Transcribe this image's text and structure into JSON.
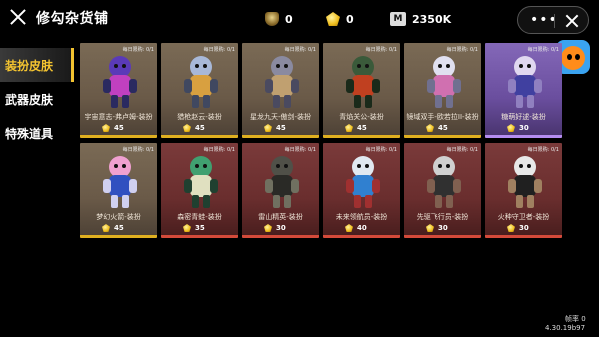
{
  "header": {
    "title": "修勾杂货铺",
    "currencies": [
      {
        "icon": "shield-coin-icon",
        "value": "0"
      },
      {
        "icon": "gold-coin-icon",
        "value": "0"
      },
      {
        "icon": "m-coin-icon",
        "label": "M",
        "value": "2350K"
      }
    ],
    "capsule": {
      "more": "•••"
    }
  },
  "sidebar": {
    "items": [
      {
        "label": "装扮皮肤",
        "active": true
      },
      {
        "label": "武器皮肤",
        "active": false
      },
      {
        "label": "特殊道具",
        "active": false
      }
    ]
  },
  "cards": [
    {
      "limit": "每日限购: 0/1",
      "name": "宇宙意志-弗卢姆-装扮",
      "price": "45",
      "rarity": "gold",
      "colors": [
        "#5a3ab8",
        "#c040c0",
        "#2a2a60"
      ]
    },
    {
      "limit": "每日限购: 0/1",
      "name": "猎枪赵云-装扮",
      "price": "45",
      "rarity": "gold",
      "colors": [
        "#a8b8d8",
        "#d8a040",
        "#404860"
      ]
    },
    {
      "limit": "每日限购: 0/1",
      "name": "星龙九天-傲剑-装扮",
      "price": "45",
      "rarity": "gold",
      "colors": [
        "#8a8aa0",
        "#c0a070",
        "#4a4a60"
      ]
    },
    {
      "limit": "每日限购: 0/1",
      "name": "青焰关公-装扮",
      "price": "45",
      "rarity": "gold",
      "colors": [
        "#3a5a3a",
        "#c04020",
        "#1a2a1a"
      ]
    },
    {
      "limit": "每日限购: 0/1",
      "name": "镜域双手-欧若拉II-装扮",
      "price": "45",
      "rarity": "gold",
      "colors": [
        "#e0e0f0",
        "#d070b0",
        "#707090"
      ]
    },
    {
      "limit": "每日限购: 0/1",
      "name": "糖萌好逑-装扮",
      "price": "30",
      "rarity": "purple",
      "colors": [
        "#e0d8f0",
        "#4040a0",
        "#9080c0"
      ]
    },
    {
      "limit": "每日限购: 0/1",
      "name": "梦幻火箭-装扮",
      "price": "45",
      "rarity": "gold",
      "colors": [
        "#f0a0d0",
        "#3050c0",
        "#d0d0f0"
      ]
    },
    {
      "limit": "每日限购: 0/1",
      "name": "森密青蛙-装扮",
      "price": "35",
      "rarity": "red",
      "colors": [
        "#40a070",
        "#e0e0c0",
        "#204030"
      ]
    },
    {
      "limit": "每日限购: 0/1",
      "name": "雷山精英-装扮",
      "price": "30",
      "rarity": "red",
      "colors": [
        "#505048",
        "#2a2a26",
        "#707060"
      ]
    },
    {
      "limit": "每日限购: 0/1",
      "name": "未来领航员-装扮",
      "price": "40",
      "rarity": "red",
      "colors": [
        "#e0e8f0",
        "#3080d0",
        "#a03030"
      ]
    },
    {
      "limit": "每日限购: 0/1",
      "name": "先驱飞行员-装扮",
      "price": "30",
      "rarity": "red",
      "colors": [
        "#d0d0d0",
        "#303030",
        "#806050"
      ]
    },
    {
      "limit": "每日限购: 0/1",
      "name": "火种守卫者-装扮",
      "price": "30",
      "rarity": "red",
      "colors": [
        "#e8e8e8",
        "#202020",
        "#a08060"
      ]
    }
  ],
  "footer": {
    "fps": "帧率 0",
    "version": "4.30.19b97"
  }
}
